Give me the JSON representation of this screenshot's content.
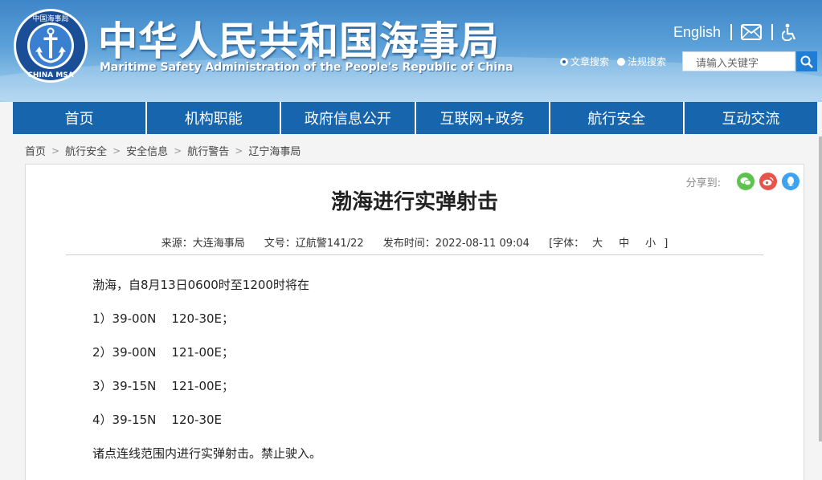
{
  "header": {
    "logo_text_top": "中国海事局",
    "logo_text_bottom": "CHINA MSA",
    "title_cn": "中华人民共和国海事局",
    "title_en": "Maritime Safety Administration of the People's Republic of China",
    "lang_link": "English",
    "icons": [
      "mail-icon",
      "accessibility-icon"
    ],
    "search": {
      "options": [
        {
          "label": "文章搜索",
          "selected": true
        },
        {
          "label": "法规搜索",
          "selected": false
        }
      ],
      "placeholder": "请输入关键字"
    }
  },
  "nav": {
    "items": [
      "首页",
      "机构职能",
      "政府信息公开",
      "互联网+政务",
      "航行安全",
      "互动交流"
    ]
  },
  "breadcrumb": [
    "首页",
    "航行安全",
    "安全信息",
    "航行警告",
    "辽宁海事局"
  ],
  "share": {
    "label": "分享到:",
    "targets": [
      "wechat-icon",
      "weibo-icon",
      "qq-icon"
    ]
  },
  "article": {
    "title": "渤海进行实弹射击",
    "source": "来源：大连海事局",
    "doc_no": "文号：辽航警141/22",
    "published": "发布时间：2022-08-11 09:04",
    "font_label": "[字体：",
    "font_sizes": [
      "大",
      "中",
      "小"
    ],
    "font_close": "]",
    "paragraphs": [
      "渤海，自8月13日0600时至1200时将在",
      "1）39-00N    120-30E；",
      "2）39-00N    121-00E；",
      "3）39-15N    121-00E；",
      "4）39-15N    120-30E",
      "诸点连线范围内进行实弹射击。禁止驶入。"
    ]
  },
  "colors": {
    "nav_bg": "#1765ad",
    "header_top": "#3f86c8",
    "search_button": "#1f7dd3"
  }
}
